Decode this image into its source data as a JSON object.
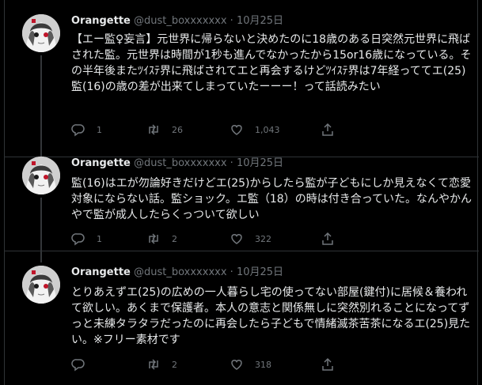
{
  "tweets": [
    {
      "name": "Orangette",
      "handle": "@dust_boxxxxxxx",
      "dot": "·",
      "date": "10月25日",
      "text": "【エー監♀妄言】元世界に帰らないと決めたのに18歳のある日突然元世界に飛ばされた監。元世界は時間が1秒も進んでなかったから15or16歳になっている。その半年後またﾂｲｽﾃ界に飛ばされてエと再会するけどﾂｲｽﾃ界は7年経っててエ(25)監(16)の歳の差が出来てしまっていたーーー！って話読みたい",
      "replies": "1",
      "retweets": "26",
      "likes": "1,043"
    },
    {
      "name": "Orangette",
      "handle": "@dust_boxxxxxxx",
      "dot": "·",
      "date": "10月25日",
      "text": "監(16)はエが勿論好きだけどエ(25)からしたら監が子どもにしか見えなくて恋愛対象にならない話。監ショック。エ監（18）の時は付き合っていた。なんやかんやで監が成人したらくっついて欲しい",
      "replies": "1",
      "retweets": "2",
      "likes": "322"
    },
    {
      "name": "Orangette",
      "handle": "@dust_boxxxxxxx",
      "dot": "·",
      "date": "10月25日",
      "text": "とりあえずエ(25)の広めの一人暮らし宅の使ってない部屋(鍵付)に居候＆養われて欲しい。あくまで保護者。本人の意志と関係無しに突然別れることになってずっと未練タラタラだったのに再会したら子どもで情緒滅茶苦茶になるエ(25)見たい。※フリー素材です",
      "replies": "",
      "retweets": "2",
      "likes": "318"
    }
  ],
  "icons": {
    "reply": "reply-icon",
    "retweet": "retweet-icon",
    "like": "heart-icon",
    "share": "share-icon"
  },
  "colors": {
    "background": "#000000",
    "text": "#e7e9ea",
    "muted": "#71767b",
    "border": "#2f3336"
  }
}
